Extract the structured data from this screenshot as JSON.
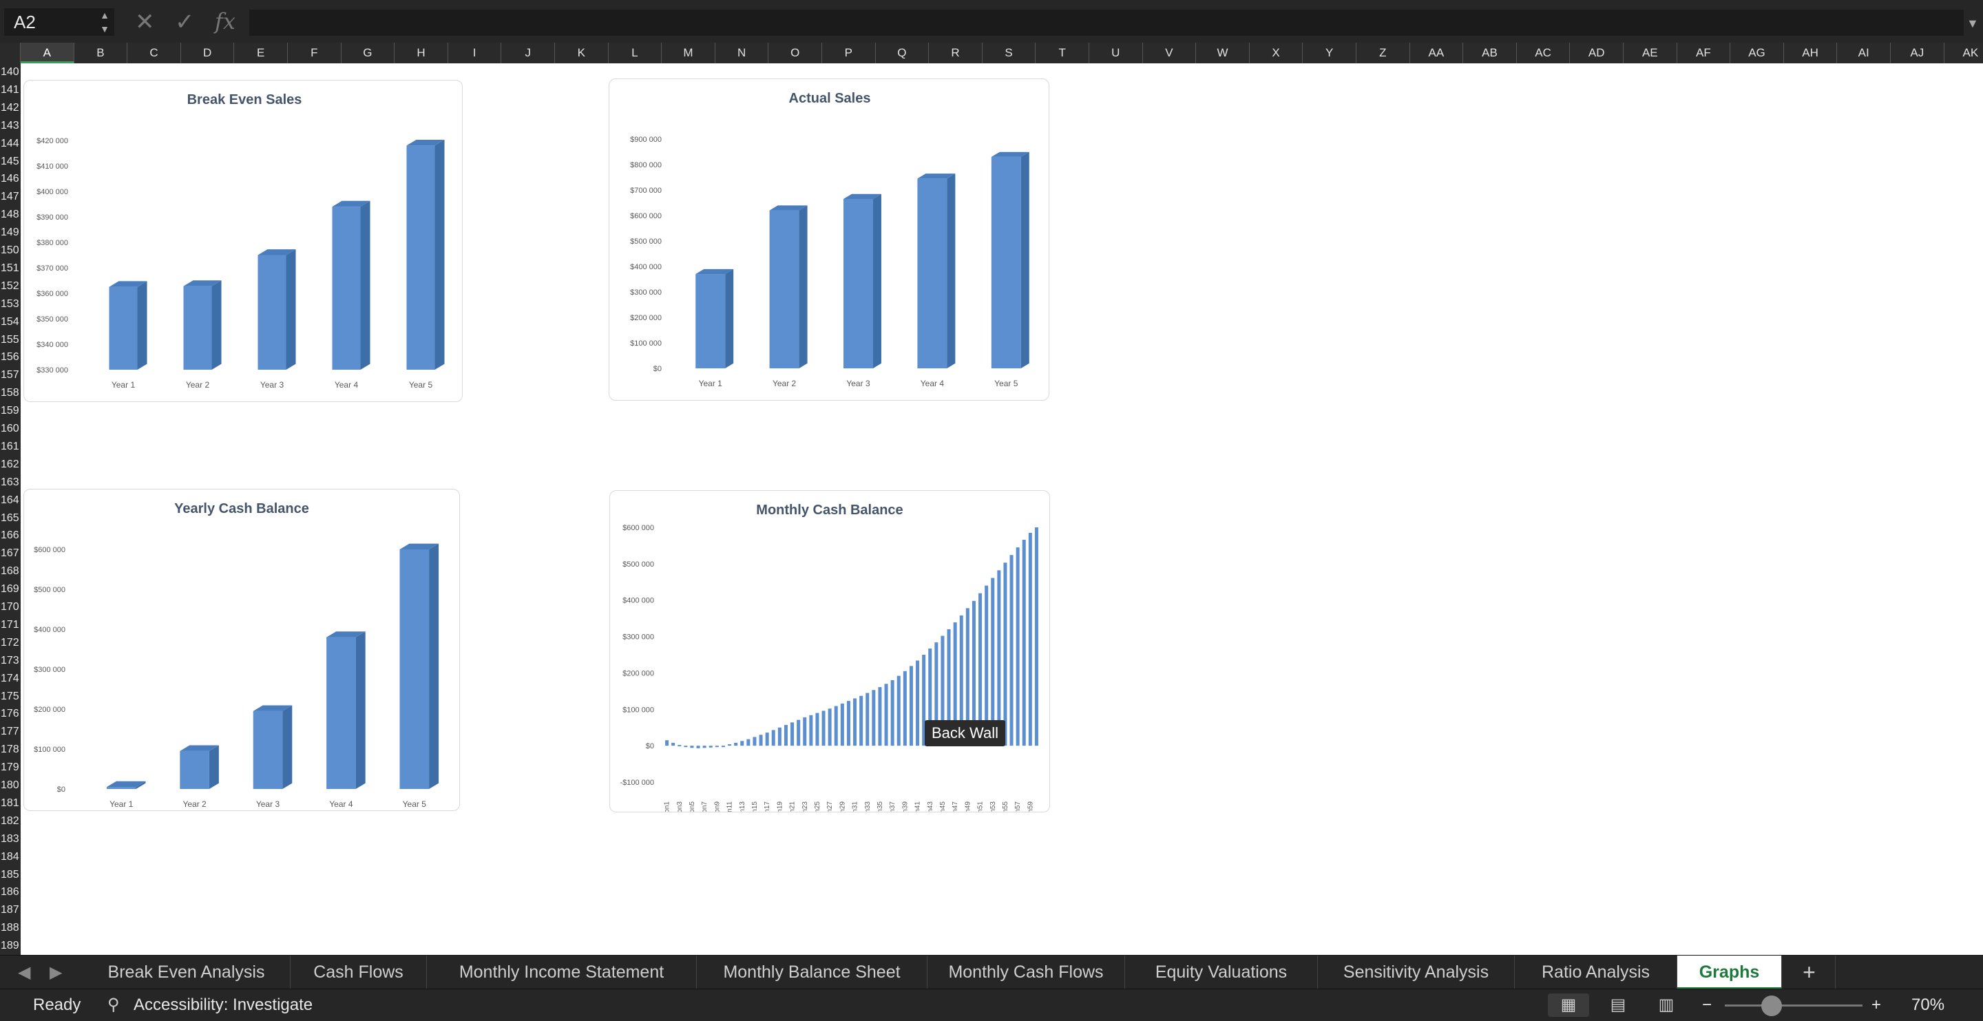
{
  "formula_bar": {
    "cell_ref": "A2",
    "cancel_icon": "x-icon",
    "enter_icon": "check-icon",
    "fx_label": "fx",
    "formula": ""
  },
  "columns": [
    "A",
    "B",
    "C",
    "D",
    "E",
    "F",
    "G",
    "H",
    "I",
    "J",
    "K",
    "L",
    "M",
    "N",
    "O",
    "P",
    "Q",
    "R",
    "S",
    "T",
    "U",
    "V",
    "W",
    "X",
    "Y",
    "Z",
    "AA",
    "AB",
    "AC",
    "AD",
    "AE",
    "AF",
    "AG",
    "AH",
    "AI",
    "AJ",
    "AK"
  ],
  "selected_column": "A",
  "rows": [
    "140",
    "141",
    "142",
    "143",
    "144",
    "145",
    "146",
    "147",
    "148",
    "149",
    "150",
    "151",
    "152",
    "153",
    "154",
    "155",
    "156",
    "157",
    "158",
    "159",
    "160",
    "161",
    "162",
    "163",
    "164",
    "165",
    "166",
    "167",
    "168",
    "169",
    "170",
    "171",
    "172",
    "173",
    "174",
    "175",
    "176",
    "177",
    "178",
    "179",
    "180",
    "181",
    "182",
    "183",
    "184",
    "185",
    "186",
    "187",
    "188",
    "189"
  ],
  "tooltip": "Back Wall",
  "chart_data": [
    {
      "type": "bar",
      "title": "Break Even Sales",
      "categories": [
        "Year 1",
        "Year 2",
        "Year 3",
        "Year 4",
        "Year 5"
      ],
      "values": [
        362500,
        362800,
        375000,
        394000,
        418000
      ],
      "ylim": [
        330000,
        420000
      ],
      "yticks": [
        "$330 000",
        "$340 000",
        "$350 000",
        "$360 000",
        "$370 000",
        "$380 000",
        "$390 000",
        "$400 000",
        "$410 000",
        "$420 000"
      ]
    },
    {
      "type": "bar",
      "title": "Actual Sales",
      "categories": [
        "Year 1",
        "Year 2",
        "Year 3",
        "Year 4",
        "Year 5"
      ],
      "values": [
        370000,
        620000,
        665000,
        745000,
        830000
      ],
      "ylim": [
        0,
        900000
      ],
      "yticks": [
        "$0",
        "$100 000",
        "$200 000",
        "$300 000",
        "$400 000",
        "$500 000",
        "$600 000",
        "$700 000",
        "$800 000",
        "$900 000"
      ]
    },
    {
      "type": "bar",
      "title": "Yearly Cash Balance",
      "categories": [
        "Year 1",
        "Year 2",
        "Year 3",
        "Year 4",
        "Year 5"
      ],
      "values": [
        5000,
        95000,
        195000,
        380000,
        600000
      ],
      "ylim": [
        0,
        600000
      ],
      "yticks": [
        "$0",
        "$100 000",
        "$200 000",
        "$300 000",
        "$400 000",
        "$500 000",
        "$600 000"
      ]
    },
    {
      "type": "bar",
      "title": "Monthly Cash Balance",
      "categories": [
        "Mon1",
        "Mon2",
        "Mon3",
        "Mon4",
        "Mon5",
        "Mon6",
        "Mon7",
        "Mon8",
        "Mon9",
        "Mon10",
        "Mon11",
        "Mon12",
        "Mon13",
        "Mon14",
        "Mon15",
        "Mon16",
        "Mon17",
        "Mon18",
        "Mon19",
        "Mon20",
        "Mon21",
        "Mon22",
        "Mon23",
        "Mon24",
        "Mon25",
        "Mon26",
        "Mon27",
        "Mon28",
        "Mon29",
        "Mon30",
        "Mon31",
        "Mon32",
        "Mon33",
        "Mon34",
        "Mon35",
        "Mon36",
        "Mon37",
        "Mon38",
        "Mon39",
        "Mon40",
        "Mon41",
        "Mon42",
        "Mon43",
        "Mon44",
        "Mon45",
        "Mon46",
        "Mon47",
        "Mon48",
        "Mon49",
        "Mon50",
        "Mon51",
        "Mon52",
        "Mon53",
        "Mon54",
        "Mon55",
        "Mon56",
        "Mon57",
        "Mon58",
        "Mon59",
        "Mon60"
      ],
      "tick_labels": [
        "Mon1",
        "Mon3",
        "Mon5",
        "Mon7",
        "Mon9",
        "Mon11",
        "Mon13",
        "Mon15",
        "Mon17",
        "Mon19",
        "Mon21",
        "Mon23",
        "Mon25",
        "Mon27",
        "Mon29",
        "Mon31",
        "Mon33",
        "Mon35",
        "Mon37",
        "Mon39",
        "Mon41",
        "Mon43",
        "Mon45",
        "Mon47",
        "Mon49",
        "Mon51",
        "Mon53",
        "Mon55",
        "Mon57",
        "Mon59"
      ],
      "values": [
        15000,
        8000,
        2000,
        -3000,
        -6000,
        -7000,
        -6000,
        -5000,
        -3000,
        0,
        4000,
        8000,
        13000,
        18000,
        24000,
        30000,
        36000,
        43000,
        50000,
        57000,
        64000,
        71000,
        78000,
        84000,
        90000,
        96000,
        102000,
        109000,
        116000,
        123000,
        130000,
        137000,
        145000,
        153000,
        161000,
        170000,
        180000,
        192000,
        205000,
        219000,
        234000,
        250000,
        267000,
        284000,
        302000,
        320000,
        339000,
        358000,
        378000,
        398000,
        419000,
        440000,
        461000,
        482000,
        503000,
        524000,
        545000,
        566000,
        585000,
        600000
      ],
      "ylim": [
        -100000,
        600000
      ],
      "yticks": [
        "-$100 000",
        "$0",
        "$100 000",
        "$200 000",
        "$300 000",
        "$400 000",
        "$500 000",
        "$600 000"
      ]
    }
  ],
  "tabs": [
    "Break Even Analysis",
    "Cash Flows",
    "Monthly Income Statement",
    "Monthly Balance Sheet",
    "Monthly Cash Flows",
    "Equity Valuations",
    "Sensitivity Analysis",
    "Ratio Analysis",
    "Graphs"
  ],
  "active_tab": "Graphs",
  "add_sheet": "+",
  "status": {
    "ready": "Ready",
    "accessibility": "Accessibility: Investigate",
    "zoom": "70%",
    "zoom_minus": "−",
    "zoom_plus": "+"
  }
}
